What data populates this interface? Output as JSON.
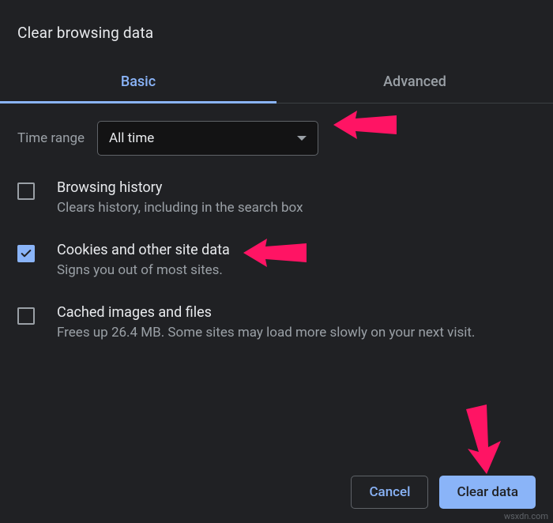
{
  "dialog": {
    "title": "Clear browsing data"
  },
  "tabs": {
    "basic": "Basic",
    "advanced": "Advanced"
  },
  "time_range": {
    "label": "Time range",
    "value": "All time"
  },
  "options": [
    {
      "checked": false,
      "title": "Browsing history",
      "desc": "Clears history, including in the search box"
    },
    {
      "checked": true,
      "title": "Cookies and other site data",
      "desc": "Signs you out of most sites."
    },
    {
      "checked": false,
      "title": "Cached images and files",
      "desc": "Frees up 26.4 MB. Some sites may load more slowly on your next visit."
    }
  ],
  "footer": {
    "cancel": "Cancel",
    "clear": "Clear data"
  },
  "watermark": "wsxdn.com",
  "colors": {
    "bg": "#202124",
    "accent": "#8ab4f8",
    "text_secondary": "#9aa0a6",
    "arrow": "#ff1464"
  }
}
